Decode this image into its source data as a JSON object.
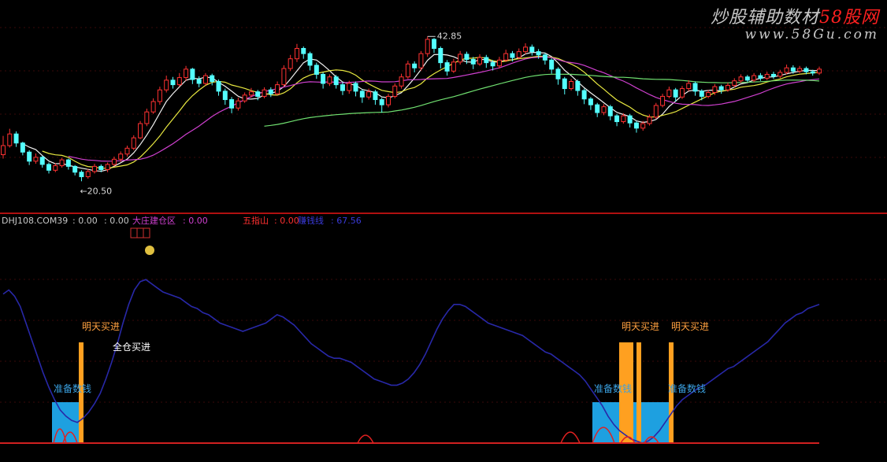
{
  "watermark": {
    "line1_a": "炒股辅助数材",
    "line1_b": "58股网",
    "line2": "www.58Gu.com"
  },
  "price_chart": {
    "high_label": "42.85",
    "low_label": "←20.50",
    "ylim": [
      17.5,
      47.5
    ],
    "candles": [
      [
        24.6,
        26.0,
        27.5,
        24.0
      ],
      [
        26.0,
        27.8,
        28.6,
        25.7
      ],
      [
        27.8,
        26.4,
        28.2,
        25.8
      ],
      [
        26.4,
        25.0,
        26.6,
        24.5
      ],
      [
        25.0,
        23.6,
        25.3,
        23.0
      ],
      [
        23.6,
        24.2,
        24.8,
        23.2
      ],
      [
        24.2,
        23.1,
        24.4,
        22.6
      ],
      [
        23.1,
        22.2,
        23.4,
        21.7
      ],
      [
        22.2,
        22.9,
        23.3,
        21.9
      ],
      [
        22.9,
        23.8,
        24.1,
        22.6
      ],
      [
        23.8,
        22.8,
        24.0,
        22.3
      ],
      [
        22.8,
        21.9,
        23.0,
        21.4
      ],
      [
        21.9,
        21.2,
        22.2,
        20.5
      ],
      [
        21.2,
        22.0,
        22.4,
        20.9
      ],
      [
        22.0,
        22.8,
        23.2,
        21.7
      ],
      [
        22.8,
        22.3,
        23.1,
        21.9
      ],
      [
        22.3,
        23.1,
        23.4,
        21.9
      ],
      [
        23.1,
        23.9,
        24.3,
        22.8
      ],
      [
        23.9,
        24.7,
        25.1,
        23.5
      ],
      [
        24.7,
        25.6,
        26.0,
        24.3
      ],
      [
        25.6,
        27.2,
        27.6,
        25.3
      ],
      [
        27.2,
        29.4,
        29.8,
        27.0
      ],
      [
        29.4,
        31.2,
        31.7,
        29.0
      ],
      [
        31.2,
        32.8,
        33.3,
        30.9
      ],
      [
        32.8,
        34.6,
        35.1,
        32.3
      ],
      [
        34.6,
        36.1,
        36.8,
        34.2
      ],
      [
        36.1,
        35.4,
        36.6,
        34.8
      ],
      [
        35.4,
        36.5,
        37.2,
        35.1
      ],
      [
        36.5,
        37.8,
        38.3,
        36.0
      ],
      [
        37.8,
        36.2,
        38.0,
        35.5
      ],
      [
        36.2,
        35.6,
        36.7,
        35.0
      ],
      [
        35.6,
        36.8,
        37.2,
        35.3
      ],
      [
        36.8,
        35.9,
        37.1,
        35.3
      ],
      [
        35.9,
        34.4,
        36.2,
        33.7
      ],
      [
        34.4,
        33.1,
        34.8,
        32.3
      ],
      [
        33.1,
        31.8,
        33.5,
        31.0
      ],
      [
        31.8,
        32.9,
        33.4,
        31.4
      ],
      [
        32.9,
        33.8,
        34.2,
        32.6
      ],
      [
        33.8,
        34.3,
        34.9,
        33.4
      ],
      [
        34.3,
        33.6,
        34.6,
        33.0
      ],
      [
        33.6,
        34.6,
        35.0,
        33.3
      ],
      [
        34.6,
        34.0,
        35.0,
        33.5
      ],
      [
        34.0,
        35.4,
        35.9,
        33.8
      ],
      [
        35.4,
        37.9,
        38.4,
        35.1
      ],
      [
        37.9,
        39.4,
        40.0,
        37.5
      ],
      [
        39.4,
        41.0,
        41.7,
        38.9
      ],
      [
        41.0,
        40.2,
        41.3,
        39.4
      ],
      [
        40.2,
        38.4,
        40.5,
        37.6
      ],
      [
        38.4,
        37.0,
        38.8,
        36.3
      ],
      [
        37.0,
        35.6,
        37.3,
        34.8
      ],
      [
        35.6,
        36.6,
        37.0,
        35.2
      ],
      [
        36.6,
        35.4,
        36.9,
        34.8
      ],
      [
        35.4,
        34.5,
        35.8,
        33.8
      ],
      [
        34.5,
        35.6,
        36.0,
        34.0
      ],
      [
        35.6,
        34.4,
        35.9,
        33.6
      ],
      [
        34.4,
        33.5,
        34.7,
        32.6
      ],
      [
        33.5,
        34.3,
        34.8,
        33.1
      ],
      [
        34.3,
        33.1,
        34.6,
        32.3
      ],
      [
        33.1,
        32.3,
        33.4,
        31.1
      ],
      [
        32.3,
        33.6,
        34.0,
        31.9
      ],
      [
        33.6,
        35.2,
        35.6,
        33.3
      ],
      [
        35.2,
        36.6,
        37.1,
        34.8
      ],
      [
        36.6,
        38.6,
        39.1,
        36.3
      ],
      [
        38.6,
        38.0,
        39.0,
        37.3
      ],
      [
        38.0,
        40.2,
        40.6,
        37.6
      ],
      [
        40.2,
        42.4,
        42.85,
        39.7
      ],
      [
        42.4,
        41.0,
        42.6,
        40.3
      ],
      [
        41.0,
        38.8,
        41.3,
        37.9
      ],
      [
        38.8,
        37.5,
        39.2,
        36.8
      ],
      [
        37.5,
        38.9,
        39.4,
        37.2
      ],
      [
        38.9,
        40.1,
        40.6,
        38.5
      ],
      [
        40.1,
        39.3,
        40.5,
        38.6
      ],
      [
        39.3,
        38.6,
        39.7,
        37.8
      ],
      [
        38.6,
        39.6,
        40.1,
        38.3
      ],
      [
        39.6,
        38.8,
        40.0,
        38.0
      ],
      [
        38.8,
        38.3,
        39.2,
        37.6
      ],
      [
        38.3,
        39.2,
        39.7,
        37.9
      ],
      [
        39.2,
        40.2,
        40.8,
        38.9
      ],
      [
        40.2,
        39.6,
        40.6,
        39.0
      ],
      [
        39.6,
        40.5,
        41.0,
        39.3
      ],
      [
        40.5,
        41.2,
        41.8,
        40.1
      ],
      [
        41.2,
        40.5,
        41.6,
        39.9
      ],
      [
        40.5,
        40.0,
        40.9,
        39.4
      ],
      [
        40.0,
        39.2,
        40.3,
        38.5
      ],
      [
        39.2,
        37.8,
        39.5,
        37.1
      ],
      [
        37.8,
        36.3,
        38.1,
        35.4
      ],
      [
        36.3,
        34.8,
        36.6,
        33.9
      ],
      [
        34.8,
        35.9,
        36.3,
        34.5
      ],
      [
        35.9,
        34.5,
        36.2,
        33.7
      ],
      [
        34.5,
        33.2,
        34.8,
        32.4
      ],
      [
        33.2,
        32.3,
        33.5,
        31.5
      ],
      [
        32.3,
        31.1,
        32.6,
        30.4
      ],
      [
        31.1,
        32.0,
        32.4,
        30.7
      ],
      [
        32.0,
        30.6,
        32.3,
        29.9
      ],
      [
        30.6,
        29.7,
        30.9,
        29.0
      ],
      [
        29.7,
        30.6,
        31.0,
        29.4
      ],
      [
        30.6,
        29.5,
        30.9,
        28.8
      ],
      [
        29.5,
        28.7,
        29.8,
        28.0
      ],
      [
        28.7,
        29.4,
        29.8,
        28.3
      ],
      [
        29.4,
        30.4,
        30.8,
        29.1
      ],
      [
        30.4,
        32.2,
        32.6,
        30.1
      ],
      [
        32.2,
        33.6,
        34.0,
        31.9
      ],
      [
        33.6,
        34.6,
        35.1,
        33.3
      ],
      [
        34.6,
        33.5,
        34.9,
        32.8
      ],
      [
        33.5,
        34.8,
        35.2,
        33.2
      ],
      [
        34.8,
        35.6,
        36.1,
        34.4
      ],
      [
        35.6,
        34.4,
        35.9,
        33.7
      ],
      [
        34.4,
        33.6,
        34.7,
        33.0
      ],
      [
        33.6,
        34.2,
        34.6,
        33.3
      ],
      [
        34.2,
        35.1,
        35.5,
        33.8
      ],
      [
        35.1,
        34.6,
        35.4,
        34.0
      ],
      [
        34.6,
        35.3,
        35.7,
        34.3
      ],
      [
        35.3,
        36.0,
        36.4,
        35.0
      ],
      [
        36.0,
        36.6,
        37.0,
        35.7
      ],
      [
        36.6,
        36.1,
        36.9,
        35.8
      ],
      [
        36.1,
        36.8,
        37.2,
        35.8
      ],
      [
        36.8,
        36.4,
        37.2,
        36.0
      ],
      [
        36.4,
        37.0,
        37.4,
        36.1
      ],
      [
        37.0,
        36.7,
        37.4,
        36.3
      ],
      [
        36.7,
        37.3,
        37.7,
        36.4
      ],
      [
        37.3,
        38.0,
        38.5,
        37.0
      ],
      [
        38.0,
        37.5,
        38.4,
        37.1
      ],
      [
        37.5,
        37.9,
        38.3,
        37.2
      ],
      [
        37.9,
        37.4,
        38.2,
        37.0
      ],
      [
        37.4,
        37.2,
        37.7,
        36.8
      ],
      [
        37.2,
        37.8,
        38.2,
        36.9
      ]
    ]
  },
  "indicator": {
    "legend": [
      {
        "text": "DHJ108.COM39",
        "color": "#c8c8c8"
      },
      {
        "text": ": 0.00",
        "color": "#c8c8c8"
      },
      {
        "text": ": 0.00",
        "color": "#c8c8c8"
      },
      {
        "text": "大庄建仓区",
        "color": "#d040d0"
      },
      {
        "text": ": 0.00",
        "color": "#d040d0"
      },
      {
        "text": "五指山",
        "color": "#ff3030"
      },
      {
        "text": ": 0.00",
        "color": "#ff3030"
      },
      {
        "text": "赚钱线",
        "color": "#3a3ad8"
      },
      {
        "text": ": 67.56",
        "color": "#3a3ad8"
      }
    ],
    "ylim": [
      0,
      100
    ],
    "blue_line": [
      72,
      74,
      71,
      66,
      58,
      50,
      42,
      34,
      27,
      21,
      16,
      13,
      11,
      10,
      12,
      15,
      19,
      24,
      31,
      39,
      48,
      58,
      67,
      74,
      78,
      79,
      77,
      75,
      73,
      72,
      71,
      70,
      68,
      66,
      65,
      63,
      62,
      60,
      58,
      57,
      56,
      55,
      54,
      55,
      56,
      57,
      58,
      60,
      62,
      61,
      59,
      57,
      54,
      51,
      48,
      46,
      44,
      42,
      41,
      41,
      40,
      39,
      37,
      35,
      33,
      31,
      30,
      29,
      28,
      28,
      29,
      31,
      34,
      38,
      43,
      49,
      55,
      60,
      64,
      67,
      67,
      66,
      64,
      62,
      60,
      58,
      57,
      56,
      55,
      54,
      53,
      52,
      50,
      48,
      46,
      44,
      43,
      41,
      39,
      37,
      35,
      33,
      30,
      26,
      22,
      18,
      13,
      9,
      6,
      4,
      2,
      1,
      0,
      1,
      3,
      6,
      10,
      14,
      18,
      21,
      23,
      25,
      27,
      28,
      30,
      32,
      34,
      36,
      37,
      39,
      41,
      43,
      45,
      47,
      49,
      52,
      55,
      58,
      60,
      62,
      63,
      65,
      66,
      67
    ],
    "red_spikes": [
      {
        "from": 0.575,
        "to": 0.6,
        "peak": 5.5
      },
      {
        "from": 0.0,
        "to": 0.0,
        "peak": 0
      },
      {
        "from": 0.0,
        "to": 0.0,
        "peak": 0
      }
    ],
    "markers": [
      {
        "kind": "prepare",
        "label": "准备数钱"
      },
      {
        "kind": "buy_tomorrow",
        "label": "明天买进"
      },
      {
        "kind": "full_buy",
        "label": "全仓买进"
      },
      {
        "kind": "prepare",
        "label": "准备数钱"
      },
      {
        "kind": "buy_tomorrow",
        "label": "明天买进"
      },
      {
        "kind": "buy_tomorrow",
        "label": "明天买进"
      },
      {
        "kind": "prepare",
        "label": "准备数钱"
      }
    ]
  }
}
